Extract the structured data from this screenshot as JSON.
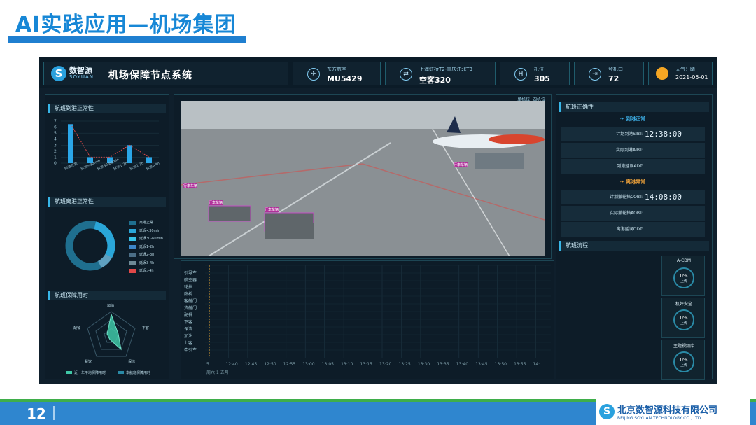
{
  "slide": {
    "title": "AI实践应用—机场集团",
    "page_number": "12"
  },
  "header": {
    "logo_cn": "数智源",
    "logo_en": "SOYUAN",
    "system_title": "机场保障节点系统",
    "airline_label": "东方航空",
    "flight_number": "MU5429",
    "route_label": "上海虹桥T2-重庆江北T3",
    "aircraft": "空客320",
    "stand_label": "机位",
    "stand_value": "305",
    "gate_label": "登机口",
    "gate_value": "72",
    "weather_label": "天气：晴",
    "date": "2021-05-01"
  },
  "left_panels": {
    "arrival_title": "航班到港正常性",
    "departure_title": "航班离港正常性",
    "duration_title": "航班保障用时"
  },
  "arrival_chart": {
    "chart_data": {
      "type": "bar",
      "categories": [
        "延误<30min",
        "延误30-60min",
        "延误1-2h",
        "延误2-3h",
        "延误>4h"
      ],
      "values": [
        6.5,
        1,
        1,
        3,
        1
      ],
      "line_values": [
        6.5,
        1,
        1,
        3,
        1
      ],
      "ylim": [
        0,
        7
      ],
      "yticks": [
        "0",
        "1",
        "2",
        "3",
        "4",
        "5",
        "6",
        "7"
      ],
      "x_labels": [
        "到港正常",
        "延误<30min",
        "延误30-60min",
        "延误1-2h",
        "延误2-3h",
        "延误>4h"
      ]
    }
  },
  "departure_legend": [
    "离港正常",
    "延误<30min",
    "延误30-60min",
    "延误1-2h",
    "延误2-3h",
    "延误3-4h",
    "延误>4h"
  ],
  "departure_colors": [
    "#1f6f8f",
    "#2aa6d8",
    "#37c3e8",
    "#3d86c8",
    "#4b6e86",
    "#6e8a96",
    "#e04848"
  ],
  "radar": {
    "axes": [
      "加油",
      "下客",
      "保洁",
      "餐饮",
      "配餐"
    ],
    "legend_avg": "近一年平均保障用时",
    "legend_this": "本航班保障用时"
  },
  "camera": {
    "btn_single": "单机位",
    "btn_four": "四机位",
    "tag_a": "行李车辆",
    "tag_b": "行李车辆",
    "tag_c": "行李车辆",
    "tag_d": "行李车辆"
  },
  "gantt": {
    "rows": [
      "引导车",
      "航空器",
      "轮挡",
      "廊桥",
      "客舱门",
      "货舱门",
      "配餐",
      "下客",
      "保洁",
      "加油",
      "上客",
      "牵引车"
    ],
    "times": [
      "5",
      "12:40",
      "12:45",
      "12:50",
      "12:55",
      "13:00",
      "13:05",
      "13:10",
      "13:15",
      "13:20",
      "13:25",
      "13:30",
      "13:35",
      "13:40",
      "13:45",
      "13:50",
      "13:55",
      "14:"
    ],
    "date_label": "周六 1 五月"
  },
  "right_panel": {
    "title": "航班正确性",
    "arrival_status": "到港正常",
    "sibt_label": "计划到港SIBT:",
    "sibt_value": "12:38:00",
    "aibt_label": "实际到港AIBT:",
    "adt_label": "到港延误ADT:",
    "departure_status": "离港异常",
    "cobt_label": "计划撤轮挡COBT:",
    "cobt_value": "14:08:00",
    "aobt_label": "实际撤轮挡AOBT:",
    "ddt_label": "离港延误DDT:",
    "process_title": "航班流程",
    "cdm": [
      {
        "title": "A-CDM",
        "pct": "0%",
        "sub": "上传"
      },
      {
        "title": "机坪安全",
        "pct": "0%",
        "sub": "上传"
      },
      {
        "title": "主题视频库",
        "pct": "0%",
        "sub": "上传"
      }
    ]
  },
  "footer": {
    "company_cn": "北京数智源科技有限公司",
    "company_en": "BEIJING SOYUAN TECHNOLOGY CO., LTD."
  }
}
